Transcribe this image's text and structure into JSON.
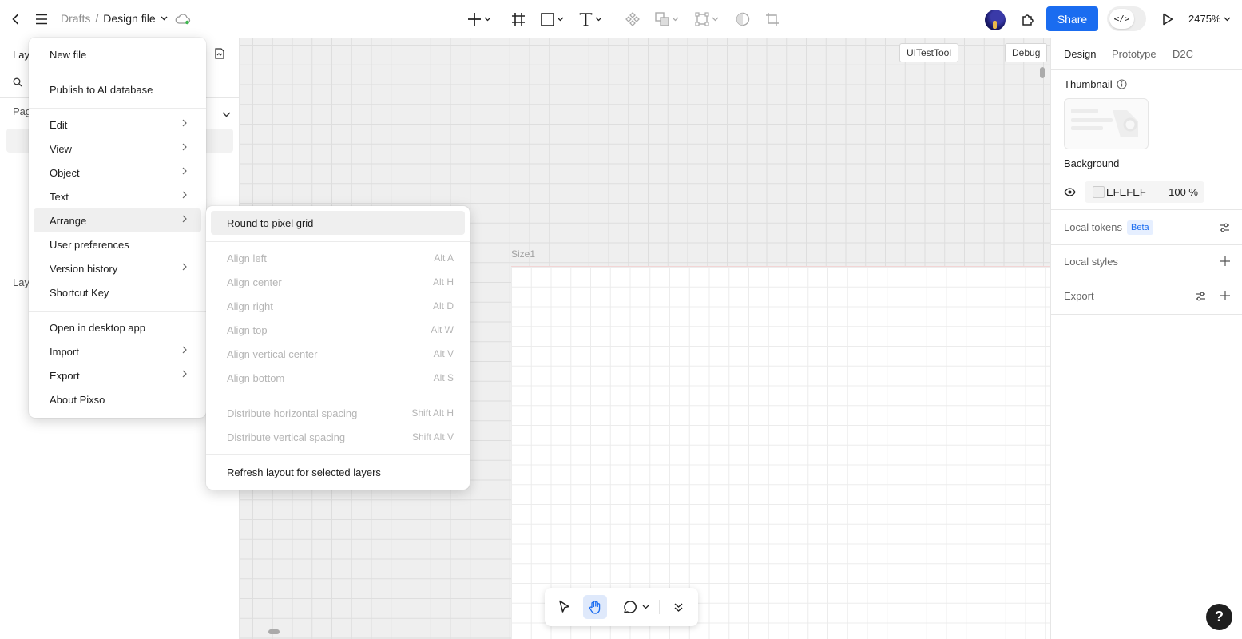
{
  "topbar": {
    "breadcrumb_parent": "Drafts",
    "breadcrumb_sep": "/",
    "file_name": "Design file",
    "share_label": "Share",
    "dev_mode_glyph": "</>",
    "zoom": "2475%"
  },
  "left_panel": {
    "layers_tab_partial": "Lay",
    "pages_label_partial": "Pag",
    "layers_label_partial": "Lay"
  },
  "main_menu": {
    "items": [
      {
        "label": "New file"
      },
      {
        "label": "Publish to AI database"
      },
      {
        "label": "Edit"
      },
      {
        "label": "View"
      },
      {
        "label": "Object"
      },
      {
        "label": "Text"
      },
      {
        "label": "Arrange"
      },
      {
        "label": "User preferences"
      },
      {
        "label": "Version history"
      },
      {
        "label": "Shortcut Key"
      },
      {
        "label": "Open in desktop app"
      },
      {
        "label": "Import"
      },
      {
        "label": "Export"
      },
      {
        "label": "About Pixso"
      }
    ]
  },
  "arrange_menu": {
    "items": [
      {
        "label": "Round to pixel grid",
        "shortcut": ""
      },
      {
        "label": "Align left",
        "shortcut": "Alt A"
      },
      {
        "label": "Align center",
        "shortcut": "Alt H"
      },
      {
        "label": "Align right",
        "shortcut": "Alt D"
      },
      {
        "label": "Align top",
        "shortcut": "Alt W"
      },
      {
        "label": "Align vertical center",
        "shortcut": "Alt V"
      },
      {
        "label": "Align bottom",
        "shortcut": "Alt S"
      },
      {
        "label": "Distribute horizontal spacing",
        "shortcut": "Shift Alt H"
      },
      {
        "label": "Distribute vertical spacing",
        "shortcut": "Shift Alt V"
      },
      {
        "label": "Refresh layout for selected layers",
        "shortcut": ""
      }
    ]
  },
  "canvas": {
    "frame_label": "Size1",
    "uitesttool_label": "UITestTool",
    "debug_label": "Debug"
  },
  "right_panel": {
    "tabs": [
      "Design",
      "Prototype",
      "D2C"
    ],
    "thumbnail_label": "Thumbnail",
    "background_label": "Background",
    "background_hex": "EFEFEF",
    "background_opacity": "100 %",
    "local_tokens_label": "Local tokens",
    "beta_badge": "Beta",
    "local_styles_label": "Local styles",
    "export_label": "Export"
  },
  "help_label": "?",
  "colors": {
    "accent": "#1a6cf0",
    "canvas_bg": "#efefef",
    "frame_bg": "#ffffff"
  }
}
